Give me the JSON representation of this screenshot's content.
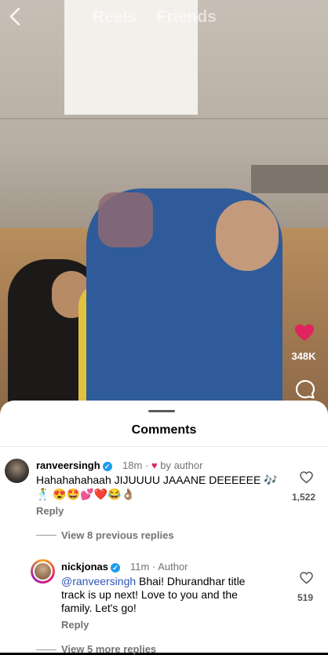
{
  "top_bar": {
    "back_icon": "chevron-left-icon",
    "tabs": [
      "Reels",
      "Friends"
    ]
  },
  "reel": {
    "like_count": "348K",
    "heart_color": "#e0245e"
  },
  "comments_sheet": {
    "title": "Comments",
    "comments": [
      {
        "username": "ranveersingh",
        "time": "18m",
        "by_author": "by author",
        "text": "Hahahahahaah JIJUUUU JAAANE DEEEEEE 🎶",
        "emojis": "🕺 😍🤩💕❤️😂👌🏽",
        "likes": "1,522",
        "reply_label": "Reply"
      },
      {
        "view_more": "View 8 previous replies"
      },
      {
        "username": "nickjonas",
        "time": "11m",
        "author_tag": "Author",
        "mention": "@ranveersingh",
        "text_line1": " Bhai! Dhurandhar title",
        "text_line2": "track is up next! Love to you and the",
        "text_line3": "family. Let's go!",
        "likes": "519",
        "reply_label": "Reply"
      },
      {
        "view_more": "View 5 more replies"
      }
    ]
  }
}
